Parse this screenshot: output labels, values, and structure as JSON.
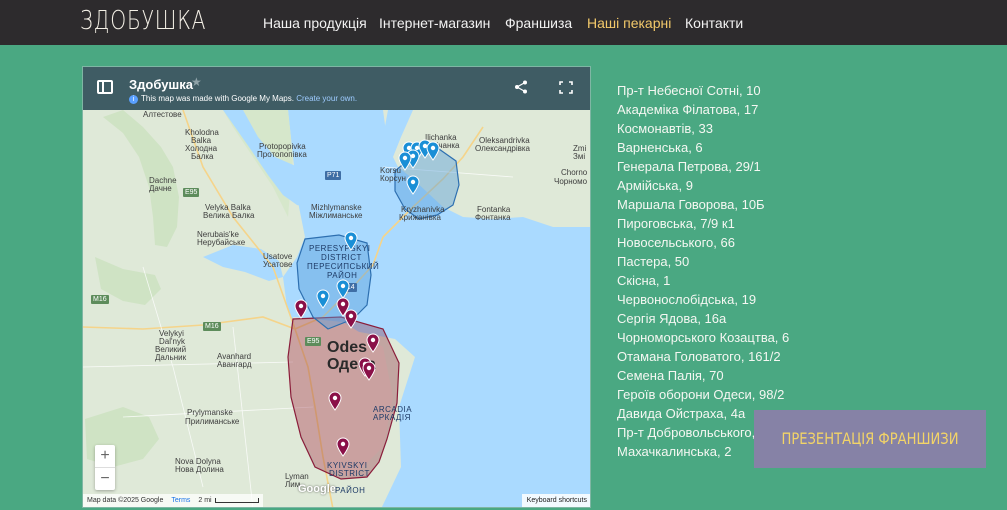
{
  "header": {
    "logo": "ЗДОБУШКА",
    "nav": [
      {
        "label": "Наша продукція"
      },
      {
        "label": "Інтернет-магазин"
      },
      {
        "label": "Франшиза"
      },
      {
        "label": "Наші пекарні"
      },
      {
        "label": "Контакти"
      }
    ],
    "active_nav": "Наші пекарні"
  },
  "map": {
    "title": "Здобушка",
    "subtitle": "This map was made with Google My Maps.",
    "subtitle_link": "Create your own.",
    "zoom_in": "+",
    "zoom_out": "−",
    "attribution": "Map data ©2025 Google",
    "terms": "Terms",
    "scale": "2 mi",
    "keyboard_shortcuts": "Keyboard shortcuts",
    "google_logo": "Google",
    "labels": {
      "altestove": "Алтестове",
      "kholodna_en": "Kholodna",
      "kholodna_en2": "Balka",
      "kholodna_uk": "Холодна",
      "kholodna_uk2": "Балка",
      "protopopivka_en": "Protopopivka",
      "protopopivka_uk": "Протопопівка",
      "dachne_en": "Dachne",
      "dachne_uk": "Дачне",
      "velyka_en": "Velyka Balka",
      "velyka_uk": "Велика Балка",
      "mizhlymanske_en": "Mizhlymanske",
      "mizhlymanske_uk": "Міжлиманське",
      "nerubais_en": "Nerubais'ke",
      "nerubais_uk": "Нерубайське",
      "usatove_en": "Usatove",
      "usatove_uk": "Усатове",
      "ilichanka_en": "Ilichanka",
      "ilichanka_uk": "Іллічанка",
      "oleksandrivka_en": "Oleksandrivka",
      "oleksandrivka_uk": "Олександрівка",
      "zmiivka": "Zmi",
      "zmiivka_uk": "Змі",
      "chorno": "Chorno",
      "chorno_uk": "Чорномо",
      "korsuntsi": "Korsu",
      "korsuntsi_uk": "Корсун",
      "kryzhanivka_en": "Kryzhanivka",
      "kryzhanivka_uk": "Крижанівка",
      "fontanka_en": "Fontanka",
      "fontanka_uk": "Фонтанка",
      "peresyp_en": "PERESYPSKYI",
      "peresyp_en2": "DISTRICT",
      "peresyp_uk": "ПЕРЕСИПСЬКИЙ",
      "peresyp_uk2": "РАЙОН",
      "velykyi_en": "Velykyi",
      "velykyi_en2": "Dal'nyk",
      "velykyi_uk": "Великий",
      "velykyi_uk2": "Дальник",
      "avanhard_en": "Avanhard",
      "avanhard_uk": "Авангард",
      "odesa_en": "Odes",
      "odesa_uk": "Одеса",
      "arcadia_en": "ARCADIA",
      "arcadia_uk": "АРКАДІЯ",
      "prylymanske_en": "Prylymanske",
      "prylymanske_uk": "Прилиманське",
      "nova_en": "Nova Dolyna",
      "nova_uk": "Нова Долина",
      "kyivskyi_en": "KYIVSKYI",
      "kyivskyi_en2": "DISTRICT",
      "kyivskyi_uk": "РАЙОН",
      "lymanka": "Lyman",
      "lymanka_uk": "Лим",
      "road_e95": "E95",
      "road_p71": "P71",
      "road_m14": "M14",
      "road_m16a": "M16",
      "road_m16b": "M16",
      "road_e95b": "E95"
    }
  },
  "addresses": [
    "Пр-т Небесної Сотні, 10",
    "Академіка Філатова, 17",
    "Космонавтів, 33",
    "Варненська, 6",
    "Генерала Петрова, 29/1",
    "Армійська, 9",
    "Маршала Говорова, 10Б",
    "Пироговська, 7/9 к1",
    "Новосельського, 66",
    "Пастера, 50",
    "Скісна, 1",
    "Червонослобідська, 19",
    "Сергія Ядова, 16а",
    "Чорноморського Козацтва, 6",
    "Отамана Головатого, 161/2",
    "Семена Палія, 70",
    "Героїв оборони Одеси, 98/2",
    "Давида Ойстраха, 4а",
    "Пр-т Добровольського,",
    "Махачкалинська, 2"
  ],
  "franchise_button": "ПРЕЗЕНТАЦІЯ ФРАНШИЗИ",
  "colors": {
    "background": "#4aa882",
    "navbar": "#2d2b2d",
    "active_nav": "#f3c96a",
    "blue_pin": "#1a8fd6",
    "red_pin": "#8a1048",
    "button": "#8682a6",
    "button_text": "#f3d467"
  }
}
